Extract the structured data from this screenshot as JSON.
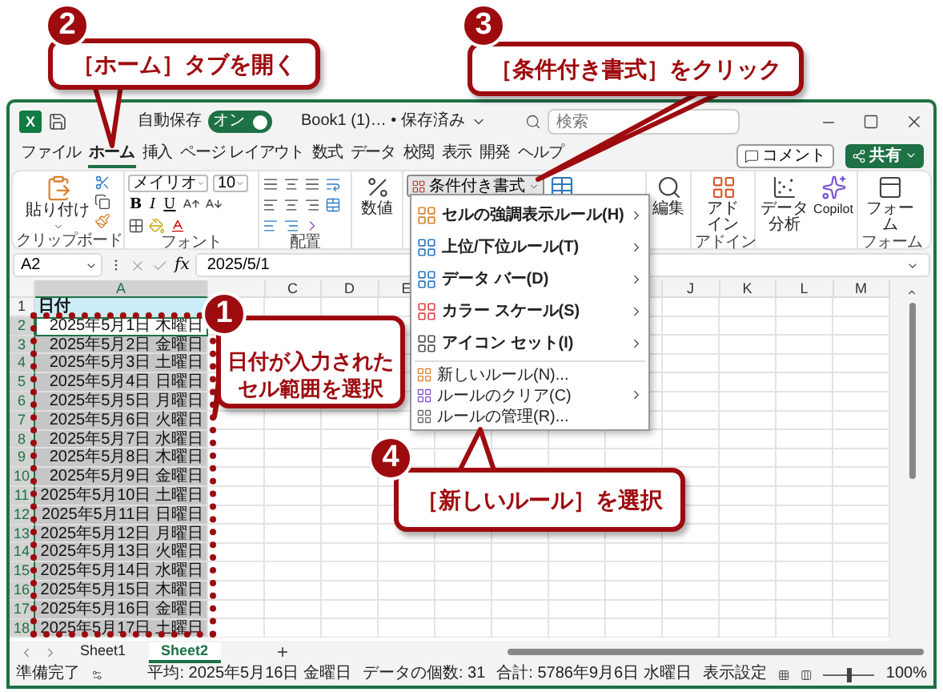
{
  "title_bar": {
    "logo": "X",
    "autosave_label": "自動保存",
    "autosave": {
      "on": true,
      "label": "オン"
    },
    "document": "Book1 (1)… • 保存済み",
    "search_placeholder": "検索"
  },
  "tabs": [
    {
      "label": "ファイル",
      "selected": false
    },
    {
      "label": "ホーム",
      "selected": true
    },
    {
      "label": "挿入",
      "selected": false
    },
    {
      "label": "ページ レイアウト",
      "selected": false
    },
    {
      "label": "数式",
      "selected": false
    },
    {
      "label": "データ",
      "selected": false
    },
    {
      "label": "校閲",
      "selected": false
    },
    {
      "label": "表示",
      "selected": false
    },
    {
      "label": "開発",
      "selected": false
    },
    {
      "label": "ヘルプ",
      "selected": false
    }
  ],
  "comment_button": "コメント",
  "share_button": "共有",
  "ribbon": {
    "clipboard": {
      "paste": "貼り付け",
      "label": "クリップボード"
    },
    "font": {
      "name": "メイリオ",
      "size": "10",
      "bold": "B",
      "italic": "I",
      "underline": "U",
      "label": "フォント"
    },
    "alignment": {
      "label": "配置"
    },
    "number": {
      "button": "数値"
    },
    "conditional_format": {
      "label": "条件付き書式",
      "expanded": true
    },
    "editing": {
      "button": "編集"
    },
    "addin": {
      "button": "アドイン",
      "label": "アドイン"
    },
    "data_analysis": {
      "button": "データ分析"
    },
    "copilot": {
      "button": "Copilot"
    },
    "forms": {
      "button": "フォーム",
      "label": "フォーム"
    }
  },
  "formula_bar": {
    "name_box": "A2",
    "fx": "fx",
    "formula": "2025/5/1"
  },
  "sheet": {
    "columns": [
      "A",
      null,
      "C",
      "D",
      "E",
      null,
      null,
      null,
      null,
      "J",
      "K",
      "L",
      "M"
    ],
    "rows": [
      {
        "number": "1",
        "value": "日付",
        "kind": "header",
        "selected": false,
        "active": false
      },
      {
        "number": "2",
        "value": "2025年5月1日 木曜日",
        "kind": "data",
        "selected": true,
        "active": true
      },
      {
        "number": "3",
        "value": "2025年5月2日 金曜日",
        "kind": "data",
        "selected": true,
        "active": false
      },
      {
        "number": "4",
        "value": "2025年5月3日 土曜日",
        "kind": "data",
        "selected": true,
        "active": false
      },
      {
        "number": "5",
        "value": "2025年5月4日 日曜日",
        "kind": "data",
        "selected": true,
        "active": false
      },
      {
        "number": "6",
        "value": "2025年5月5日 月曜日",
        "kind": "data",
        "selected": true,
        "active": false
      },
      {
        "number": "7",
        "value": "2025年5月6日 火曜日",
        "kind": "data",
        "selected": true,
        "active": false
      },
      {
        "number": "8",
        "value": "2025年5月7日 水曜日",
        "kind": "data",
        "selected": true,
        "active": false
      },
      {
        "number": "9",
        "value": "2025年5月8日 木曜日",
        "kind": "data",
        "selected": true,
        "active": false
      },
      {
        "number": "10",
        "value": "2025年5月9日 金曜日",
        "kind": "data",
        "selected": true,
        "active": false
      },
      {
        "number": "11",
        "value": "2025年5月10日 土曜日",
        "kind": "data",
        "selected": true,
        "active": false
      },
      {
        "number": "12",
        "value": "2025年5月11日 日曜日",
        "kind": "data",
        "selected": true,
        "active": false
      },
      {
        "number": "13",
        "value": "2025年5月12日 月曜日",
        "kind": "data",
        "selected": true,
        "active": false
      },
      {
        "number": "14",
        "value": "2025年5月13日 火曜日",
        "kind": "data",
        "selected": true,
        "active": false
      },
      {
        "number": "15",
        "value": "2025年5月14日 水曜日",
        "kind": "data",
        "selected": true,
        "active": false
      },
      {
        "number": "16",
        "value": "2025年5月15日 木曜日",
        "kind": "data",
        "selected": true,
        "active": false
      },
      {
        "number": "17",
        "value": "2025年5月16日 金曜日",
        "kind": "data",
        "selected": true,
        "active": false
      },
      {
        "number": "18",
        "value": "2025年5月17日 土曜日",
        "kind": "data",
        "selected": true,
        "active": false
      }
    ]
  },
  "sheet_tabs": [
    {
      "label": "Sheet1",
      "selected": false
    },
    {
      "label": "Sheet2",
      "selected": true
    }
  ],
  "add_sheet": "+",
  "status_bar": {
    "ready": "準備完了",
    "average": "平均: 2025年5月16日 金曜日",
    "count": "データの個数: 31",
    "sum": "合計: 5786年9月6日 水曜日",
    "display_settings": "表示設定",
    "zoom": {
      "level": 0.5,
      "label": "100%"
    }
  },
  "cf_menu": {
    "items": [
      {
        "kind": "large",
        "label": "セルの強調表示ルール(H)",
        "submenu": true
      },
      {
        "kind": "large",
        "label": "上位/下位ルール(T)",
        "submenu": true
      },
      {
        "kind": "large",
        "label": "データ バー(D)",
        "submenu": true
      },
      {
        "kind": "large",
        "label": "カラー スケール(S)",
        "submenu": true
      },
      {
        "kind": "large",
        "label": "アイコン セット(I)",
        "submenu": true
      },
      {
        "kind": "small",
        "label": "新しいルール(N)...",
        "submenu": false
      },
      {
        "kind": "small",
        "label": "ルールのクリア(C)",
        "submenu": true
      },
      {
        "kind": "small",
        "label": "ルールの管理(R)...",
        "submenu": false
      }
    ]
  },
  "callouts": [
    {
      "number": "2",
      "text": "［ホーム］タブを開く"
    },
    {
      "number": "3",
      "text": "［条件付き書式］をクリック"
    },
    {
      "number": "1",
      "text": "日付が入力されたセル範囲を選択"
    },
    {
      "number": "4",
      "text": "［新しいルール］を選択"
    }
  ]
}
